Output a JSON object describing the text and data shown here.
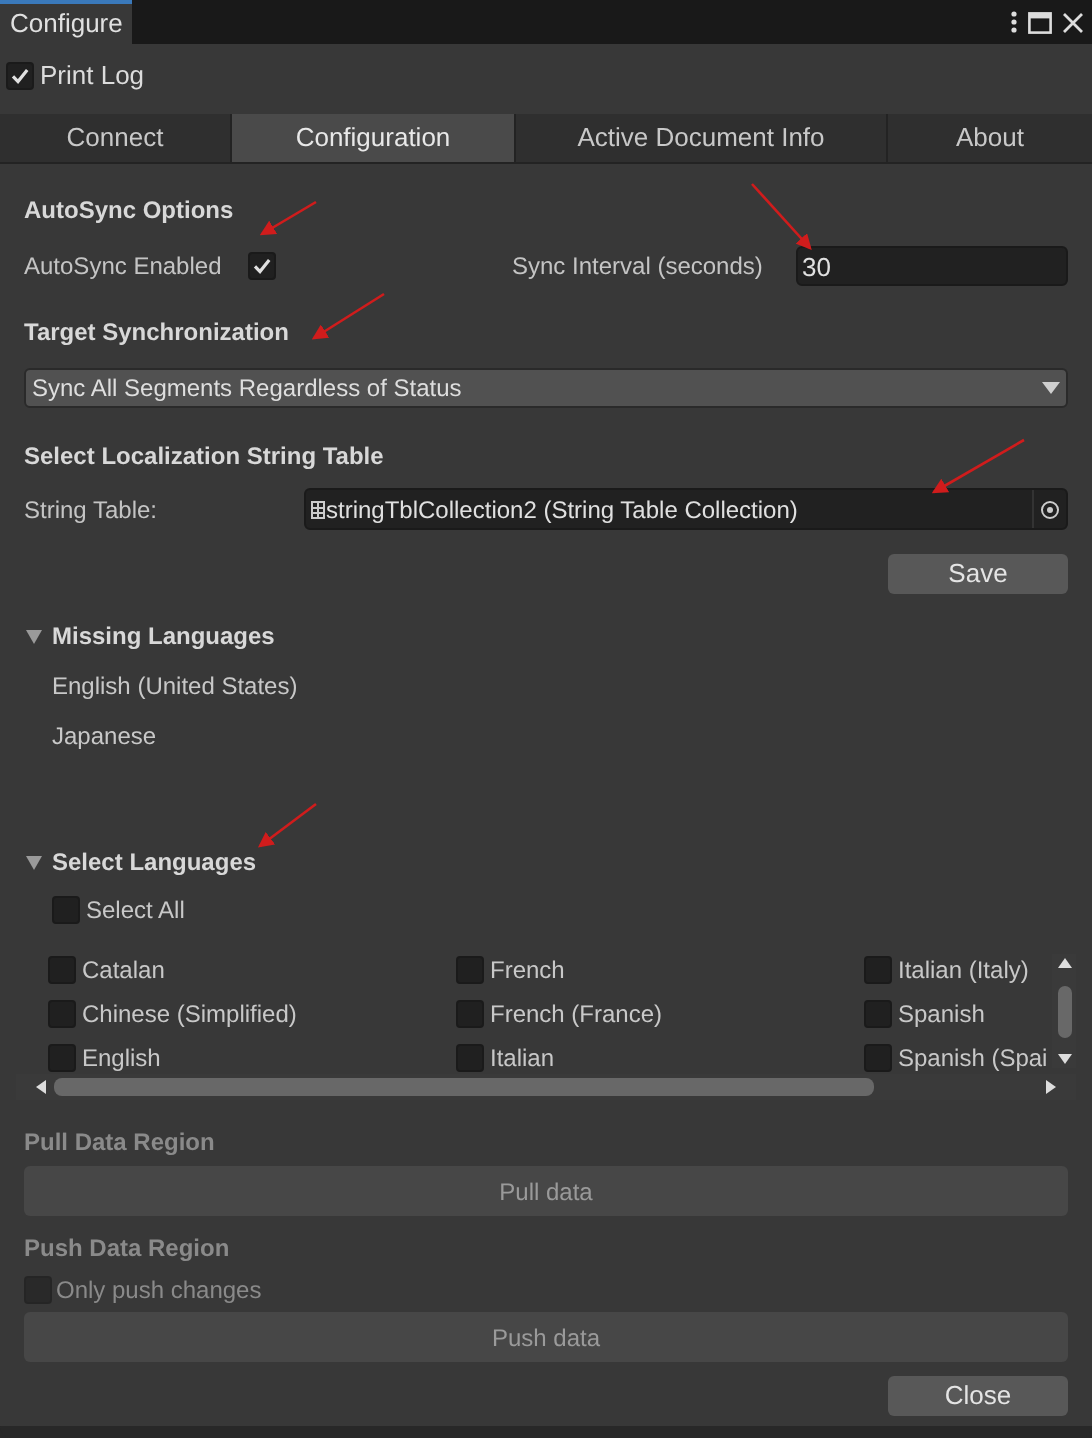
{
  "window": {
    "title": "Configure"
  },
  "print_log": {
    "label": "Print Log",
    "checked": true
  },
  "tabs": [
    {
      "label": "Connect",
      "selected": false
    },
    {
      "label": "Configuration",
      "selected": true
    },
    {
      "label": "Active Document Info",
      "selected": false
    },
    {
      "label": "About",
      "selected": false
    }
  ],
  "autosync": {
    "heading": "AutoSync Options",
    "enabled_label": "AutoSync Enabled",
    "enabled": true,
    "interval_label": "Sync Interval (seconds)",
    "interval_value": "30"
  },
  "target_sync": {
    "heading": "Target Synchronization",
    "value": "Sync All Segments Regardless of Status"
  },
  "string_table": {
    "heading": "Select Localization String Table",
    "label": "String Table:",
    "value": "stringTblCollection2 (String Table Collection)",
    "save": "Save"
  },
  "missing_languages": {
    "heading": "Missing Languages",
    "expanded": true,
    "items": [
      "English (United States)",
      "Japanese"
    ]
  },
  "select_languages": {
    "heading": "Select Languages",
    "expanded": true,
    "select_all": {
      "label": "Select All",
      "checked": false
    },
    "items": [
      {
        "label": "Catalan",
        "checked": false
      },
      {
        "label": "Chinese (Simplified)",
        "checked": false
      },
      {
        "label": "English",
        "checked": false
      },
      {
        "label": "French",
        "checked": false
      },
      {
        "label": "French (France)",
        "checked": false
      },
      {
        "label": "Italian",
        "checked": false
      },
      {
        "label": "Italian (Italy)",
        "checked": false
      },
      {
        "label": "Spanish",
        "checked": false
      },
      {
        "label": "Spanish (Spai",
        "checked": false
      }
    ]
  },
  "pull": {
    "heading": "Pull Data Region",
    "button": "Pull data",
    "disabled": true
  },
  "push": {
    "heading": "Push Data Region",
    "option": {
      "label": "Only push changes",
      "checked": false
    },
    "button": "Push data",
    "disabled": true
  },
  "close": "Close"
}
